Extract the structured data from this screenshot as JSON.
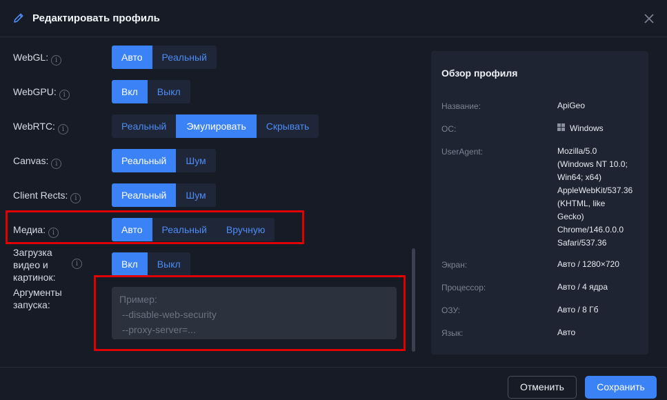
{
  "dialog": {
    "title": "Редактировать профиль"
  },
  "rows": {
    "webgl": {
      "label": "WebGL:",
      "options": [
        "Авто",
        "Реальный"
      ],
      "selected": "Авто"
    },
    "webgpu": {
      "label": "WebGPU:",
      "options": [
        "Вкл",
        "Выкл"
      ],
      "selected": "Вкл"
    },
    "webrtc": {
      "label": "WebRTC:",
      "options": [
        "Реальный",
        "Эмулировать",
        "Скрывать"
      ],
      "selected": "Эмулировать"
    },
    "canvas": {
      "label": "Canvas:",
      "options": [
        "Реальный",
        "Шум"
      ],
      "selected": "Реальный"
    },
    "client_rects": {
      "label": "Client Rects:",
      "options": [
        "Реальный",
        "Шум"
      ],
      "selected": "Реальный"
    },
    "media": {
      "label": "Медиа:",
      "options": [
        "Авто",
        "Реальный",
        "Вручную"
      ],
      "selected": "Авто"
    },
    "load_media": {
      "label_lines": [
        "Загрузка",
        "видео и",
        "картинок:"
      ],
      "options": [
        "Вкл",
        "Выкл"
      ],
      "selected": "Вкл"
    },
    "launch_args": {
      "label_lines": [
        "Аргументы",
        "запуска:"
      ],
      "placeholder": "Пример:\n --disable-web-security\n --proxy-server=..."
    }
  },
  "overview": {
    "title": "Обзор профиля",
    "name_key": "Название:",
    "name_val": "ApiGeo",
    "os_key": "ОС:",
    "os_val": "Windows",
    "ua_key": "UserAgent:",
    "ua_lines": [
      "Mozilla/5.0",
      "(Windows NT 10.0;",
      "Win64; x64)",
      "AppleWebKit/537.36",
      "(KHTML, like",
      "Gecko)",
      "Chrome/146.0.0.0",
      "Safari/537.36"
    ],
    "screen_key": "Экран:",
    "screen_val": "Авто / 1280×720",
    "cpu_key": "Процессор:",
    "cpu_val": "Авто / 4 ядра",
    "ram_key": "ОЗУ:",
    "ram_val": "Авто / 8 Гб",
    "lang_key": "Язык:",
    "lang_val": "Авто"
  },
  "footer": {
    "cancel": "Отменить",
    "save": "Сохранить"
  },
  "colors": {
    "accent": "#3b82f6",
    "highlight": "#e00000",
    "background": "#161b26"
  }
}
